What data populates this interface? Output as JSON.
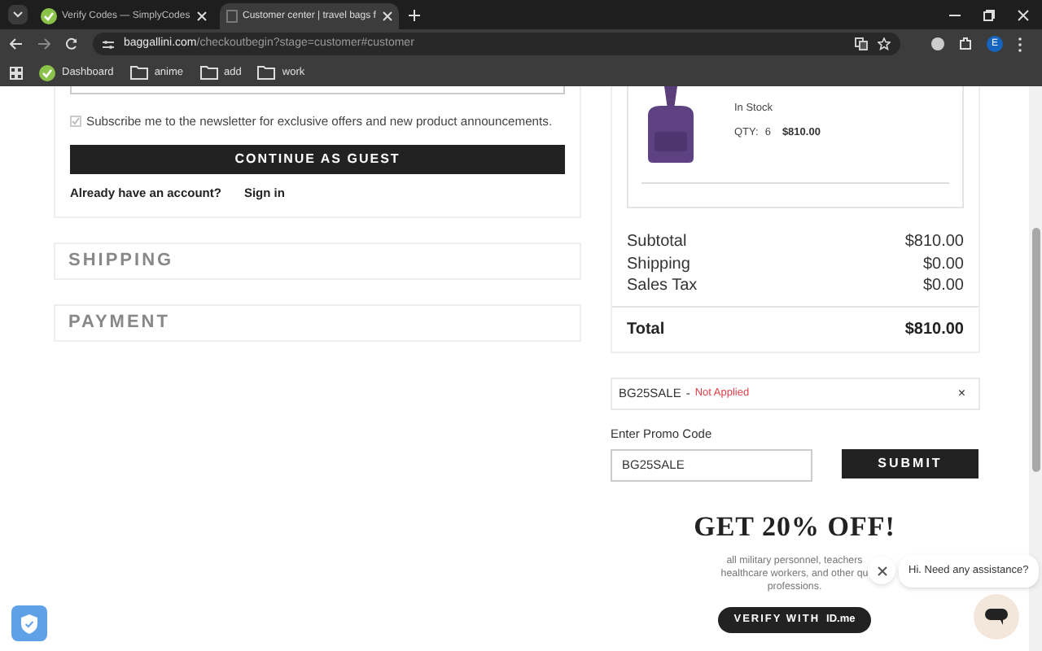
{
  "browser": {
    "tabs": [
      {
        "title": "Verify Codes — SimplyCodes",
        "selected": false
      },
      {
        "title": "Customer center | travel bags f",
        "selected": true
      }
    ],
    "url": {
      "host": "baggallini.com",
      "path": "/checkoutbegin?stage=customer#customer"
    },
    "profile": "E",
    "bookmarks": [
      {
        "label": "Dashboard",
        "kind": "site"
      },
      {
        "label": "anime",
        "kind": "folder"
      },
      {
        "label": "add",
        "kind": "folder"
      },
      {
        "label": "work",
        "kind": "folder"
      }
    ]
  },
  "checkout": {
    "newsletter": {
      "label": "Subscribe me to the newsletter for exclusive offers and new product announcements.",
      "checked": true
    },
    "continue_button": "CONTINUE AS GUEST",
    "account_prompt": "Already have an account?",
    "sign_in": "Sign in",
    "sections": [
      {
        "title": "SHIPPING"
      },
      {
        "title": "PAYMENT"
      }
    ]
  },
  "order": {
    "item": {
      "stock": "In Stock",
      "qty_label": "QTY:",
      "qty": "6",
      "price": "$810.00"
    },
    "lines": [
      {
        "label": "Subtotal",
        "value": "$810.00"
      },
      {
        "label": "Shipping",
        "value": "$0.00"
      },
      {
        "label": "Sales Tax",
        "value": "$0.00"
      }
    ],
    "total": {
      "label": "Total",
      "value": "$810.00"
    },
    "coupon": {
      "code": "BG25SALE",
      "separator": "-",
      "status": "Not Applied",
      "remove": "×"
    },
    "promo": {
      "label": "Enter Promo Code",
      "value": "BG25SALE",
      "submit": "SUBMIT"
    }
  },
  "offer": {
    "title": "GET 20% OFF!",
    "text": "all military personnel, teachers\nhealthcare workers, and other qu\nprofessions.",
    "verify": "VERIFY WITH",
    "verify_brand": "ID.me"
  },
  "chat": {
    "message": "Hi. Need any assistance?"
  }
}
